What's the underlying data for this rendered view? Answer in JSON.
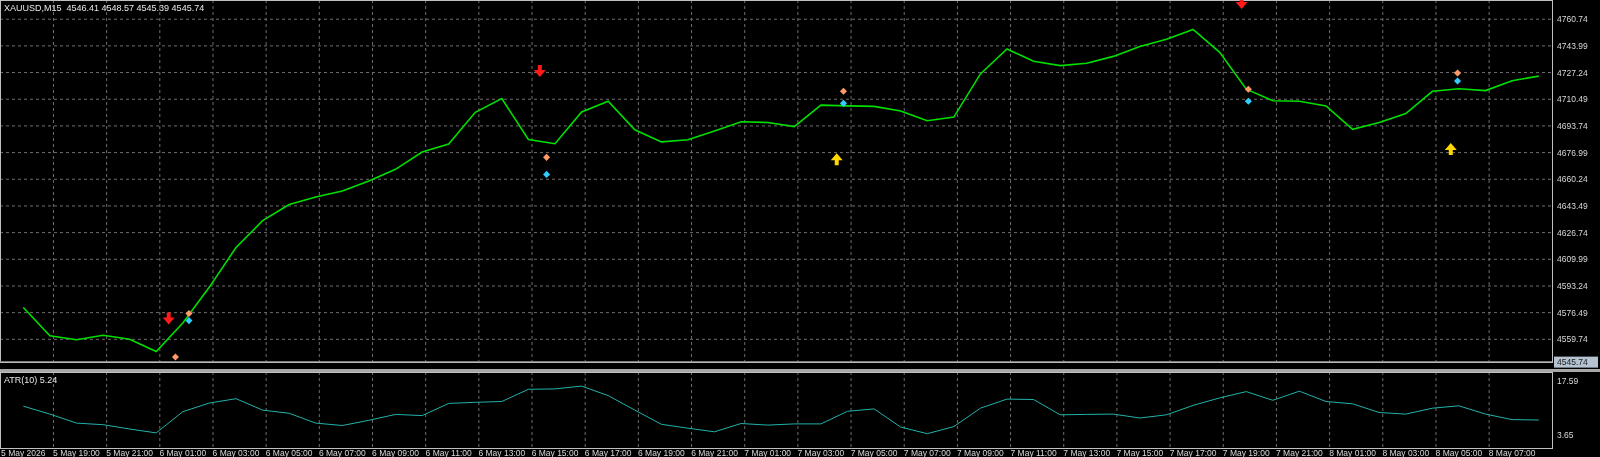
{
  "main_chart": {
    "current_price": "4545.74",
    "chart_data": {
      "type": "line",
      "title": "XAUUSD,M15  4546.41 4548.57 4545.39 4545.74",
      "grid": true,
      "series": [
        {
          "color": "#00e000",
          "values": [
            4579.7,
            4562,
            4559.5,
            4562.3,
            4559.8,
            4552,
            4570,
            4592.5,
            4617.4,
            4634.3,
            4644.4,
            4649.1,
            4652.8,
            4659.2,
            4666.5,
            4677.3,
            4682.4,
            4702.3,
            4710.9,
            4685.2,
            4682.6,
            4702.5,
            4709.2,
            4691.3,
            4683.7,
            4685,
            4690.6,
            4696.4,
            4695.9,
            4693.3,
            4706.8,
            4706.3,
            4706,
            4703.1,
            4697,
            4699.3,
            4726.4,
            4742.1,
            4734.3,
            4731.6,
            4733.1,
            4737.4,
            4743.6,
            4748.2,
            4754.3,
            4739.9,
            4716.8,
            4709.6,
            4709.2,
            4706.3,
            4691.6,
            4695.8,
            4701.5,
            4715.5,
            4717.1,
            4715.9,
            4722.1,
            4725
          ]
        }
      ],
      "ylim": [
        4545.5,
        4772.8
      ],
      "yticks": [
        {
          "value": 4559.74,
          "label": "4559.74"
        },
        {
          "value": 4576.49,
          "label": "4576.49"
        },
        {
          "value": 4593.24,
          "label": "4593.24"
        },
        {
          "value": 4609.99,
          "label": "4609.99"
        },
        {
          "value": 4626.74,
          "label": "4626.74"
        },
        {
          "value": 4643.49,
          "label": "4643.49"
        },
        {
          "value": 4660.24,
          "label": "4660.24"
        },
        {
          "value": 4676.99,
          "label": "4676.99"
        },
        {
          "value": 4693.74,
          "label": "4693.74"
        },
        {
          "value": 4710.49,
          "label": "4710.49"
        },
        {
          "value": 4727.24,
          "label": "4727.24"
        },
        {
          "value": 4743.99,
          "label": "4743.99"
        },
        {
          "value": 4760.74,
          "label": "4760.74"
        }
      ]
    },
    "signals": [
      {
        "kind": "sell_arrow"
      },
      {
        "kind": "sell_arrow"
      },
      {
        "kind": "sell_arrow"
      },
      {
        "kind": "buy_arrow"
      },
      {
        "kind": "buy_arrow"
      },
      {
        "kind": "diamond",
        "color": "#ff9966"
      },
      {
        "kind": "diamond",
        "color": "#ff9966"
      },
      {
        "kind": "diamond",
        "color": "#ff9966"
      },
      {
        "kind": "diamond",
        "color": "#ff9966"
      },
      {
        "kind": "diamond",
        "color": "#ff9966"
      },
      {
        "kind": "diamond",
        "color": "#ff9966"
      },
      {
        "kind": "diamond",
        "color": "#33ccff"
      },
      {
        "kind": "diamond",
        "color": "#33ccff"
      },
      {
        "kind": "diamond",
        "color": "#33ccff"
      },
      {
        "kind": "diamond",
        "color": "#33ccff"
      },
      {
        "kind": "diamond",
        "color": "#33ccff"
      }
    ]
  },
  "indicator": {
    "chart_data": {
      "type": "line",
      "title": "ATR(10) 5.24",
      "grid": true,
      "categories": [
        "5 May 2026",
        null,
        "5 May 19:00",
        null,
        "5 May 21:00",
        null,
        "6 May 01:00",
        null,
        "6 May 03:00",
        null,
        "6 May 05:00",
        null,
        "6 May 07:00",
        null,
        "6 May 09:00",
        null,
        "6 May 11:00",
        null,
        "6 May 13:00",
        null,
        "6 May 15:00",
        null,
        "6 May 17:00",
        null,
        "6 May 19:00",
        null,
        "6 May 21:00",
        null,
        "7 May 01:00",
        null,
        "7 May 03:00",
        null,
        "7 May 05:00",
        null,
        "7 May 07:00",
        null,
        "7 May 09:00",
        null,
        "7 May 11:00",
        null,
        "7 May 13:00",
        null,
        "7 May 15:00",
        null,
        "7 May 17:00",
        null,
        "7 May 19:00",
        null,
        "7 May 21:00",
        null,
        "8 May 01:00",
        null,
        "8 May 03:00",
        null,
        "8 May 05:00",
        null,
        "8 May 07:00",
        null
      ],
      "series": [
        {
          "color": "#20b2aa",
          "values": [
            11.1,
            9.1,
            6.8,
            6.4,
            5.3,
            4.3,
            9.7,
            11.9,
            13,
            10.1,
            9.3,
            6.8,
            6.2,
            7.5,
            9,
            8.7,
            11.8,
            12.1,
            12.3,
            15.4,
            15.5,
            16.2,
            13.8,
            10.1,
            6.5,
            5.5,
            4.6,
            6.7,
            6.3,
            6.6,
            6.6,
            9.8,
            10.4,
            5.8,
            4.1,
            5.9,
            10.6,
            12.9,
            12.8,
            8.9,
            9,
            9.1,
            8.1,
            8.9,
            11.3,
            13.2,
            14.8,
            12.6,
            14.9,
            12.3,
            11.7,
            9.5,
            9.1,
            10.6,
            11.2,
            9.1,
            7.7,
            7.6
          ]
        }
      ],
      "ylim": [
        0.47,
        19.79
      ],
      "yticks": [
        {
          "value": 3.65,
          "label": "3.65"
        },
        {
          "value": 17.59,
          "label": "17.59"
        }
      ]
    }
  }
}
